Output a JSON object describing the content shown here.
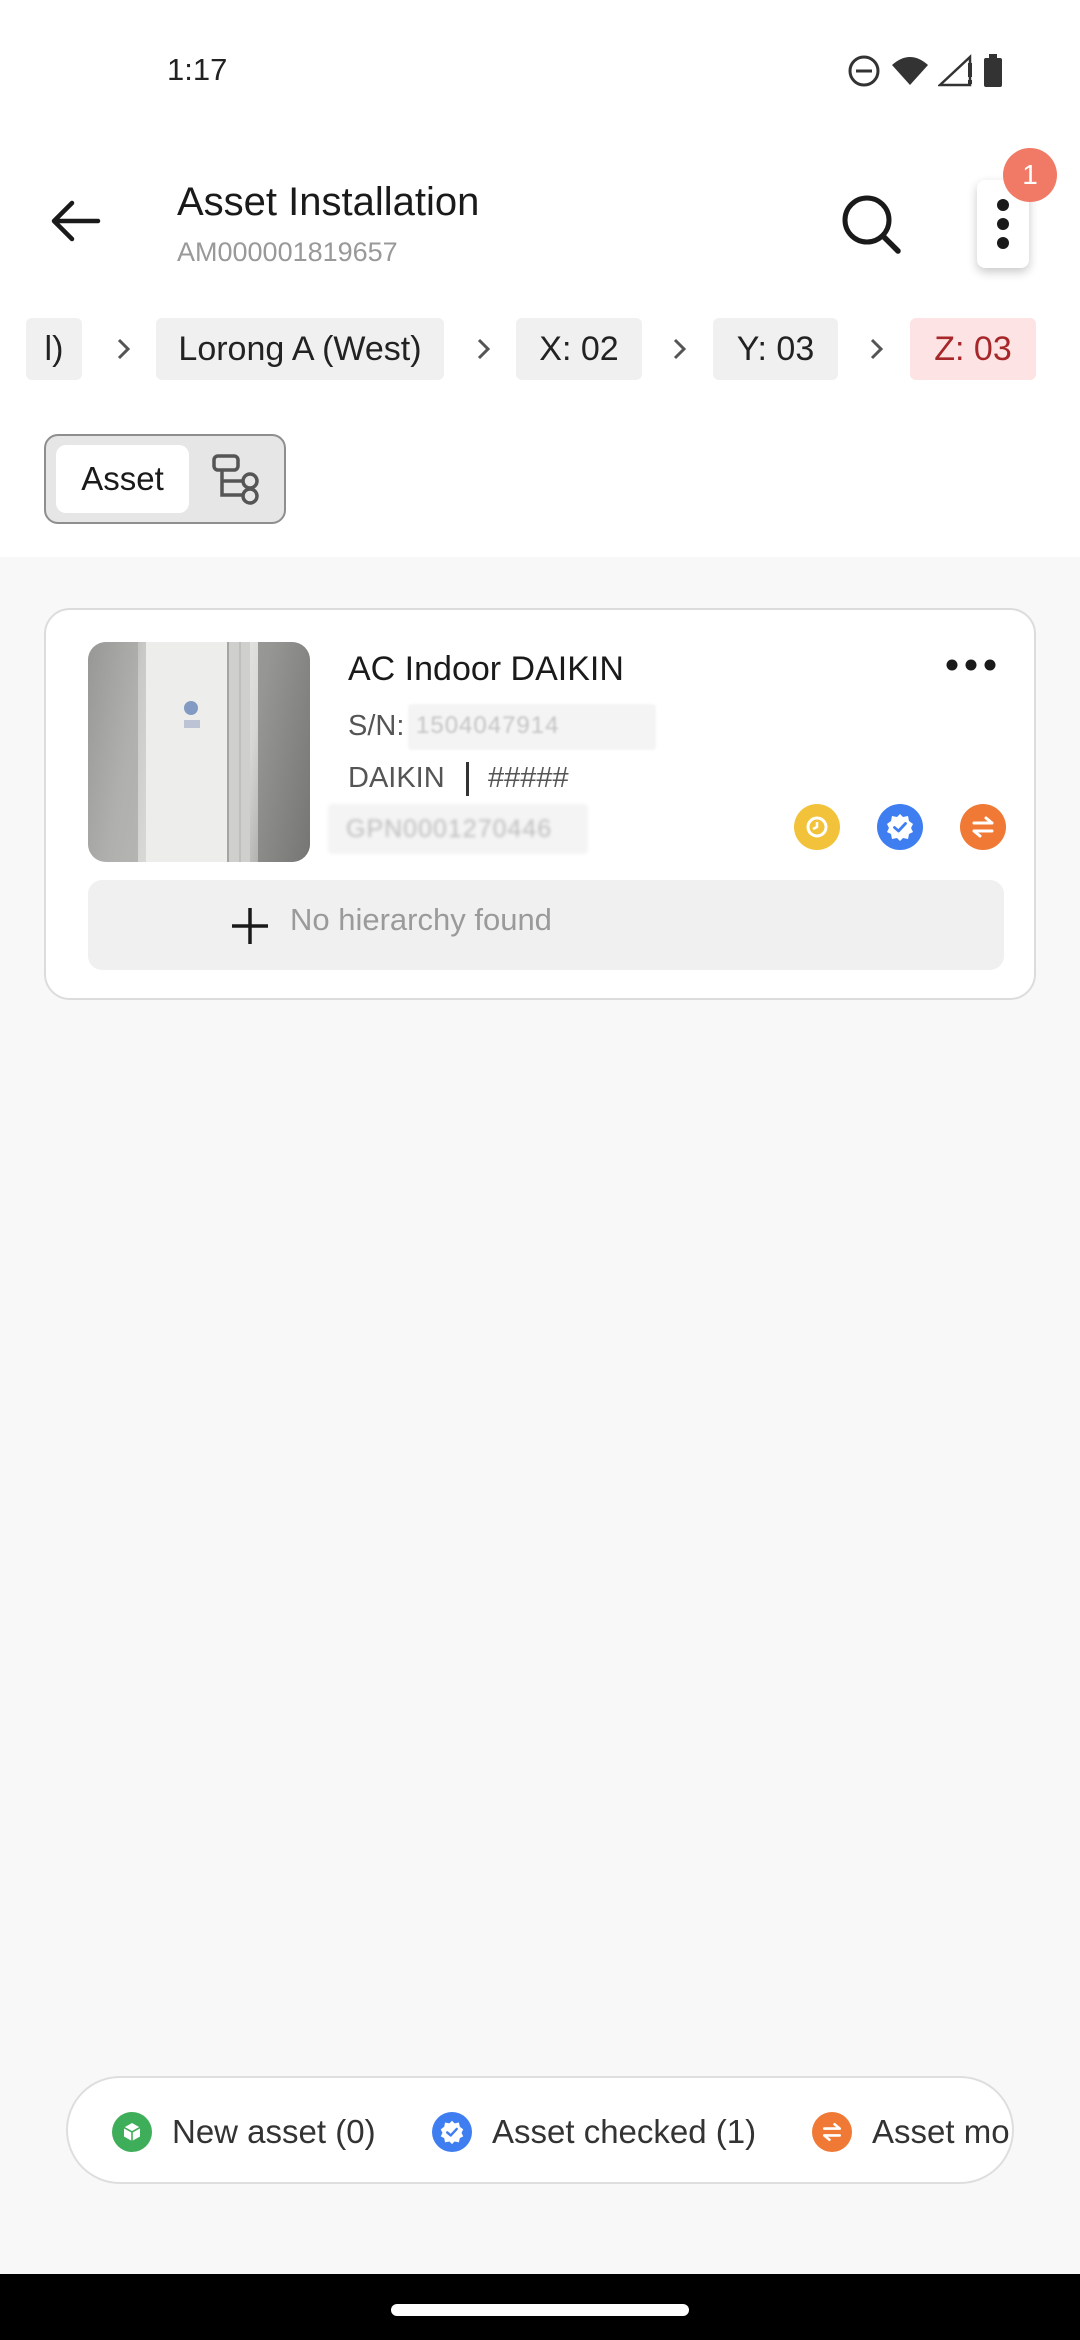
{
  "status_bar": {
    "time": "1:17",
    "icons": [
      "do-not-disturb-icon",
      "wifi-icon",
      "signal-icon",
      "battery-icon"
    ]
  },
  "app_bar": {
    "title": "Asset Installation",
    "subtitle": "AM000001819657",
    "notification_count": "1"
  },
  "breadcrumb": {
    "items": [
      {
        "label": "l)"
      },
      {
        "label": "Lorong A (West)"
      },
      {
        "label": "X: 02"
      },
      {
        "label": "Y: 03"
      },
      {
        "label": "Z: 03",
        "active": true
      }
    ]
  },
  "view_toggle": {
    "asset_label": "Asset",
    "selected": "asset"
  },
  "asset_card": {
    "title": "AC Indoor DAIKIN",
    "sn_label": "S/N:",
    "sn_value": "1504047914",
    "brand": "DAIKIN",
    "model": "#####",
    "tag_id": "GPN0001270446",
    "status_icons": [
      "pending-icon",
      "checked-icon",
      "modified-icon"
    ],
    "add_hierarchy_label": "No hierarchy found"
  },
  "legend": {
    "items": [
      {
        "label": "New asset (0)",
        "icon": "new-asset-icon",
        "color": "#3fae5a"
      },
      {
        "label": "Asset checked (1)",
        "icon": "checked-icon",
        "color": "#3f7ef0"
      },
      {
        "label": "Asset mo",
        "icon": "modified-icon",
        "color": "#f07a35"
      }
    ]
  },
  "colors": {
    "accent_active_bg": "#fde3e3",
    "accent_active_text": "#a6262a",
    "badge": "#f07a66",
    "pending": "#f2c33a",
    "checked": "#3f7ef0",
    "modified": "#f07a35"
  }
}
